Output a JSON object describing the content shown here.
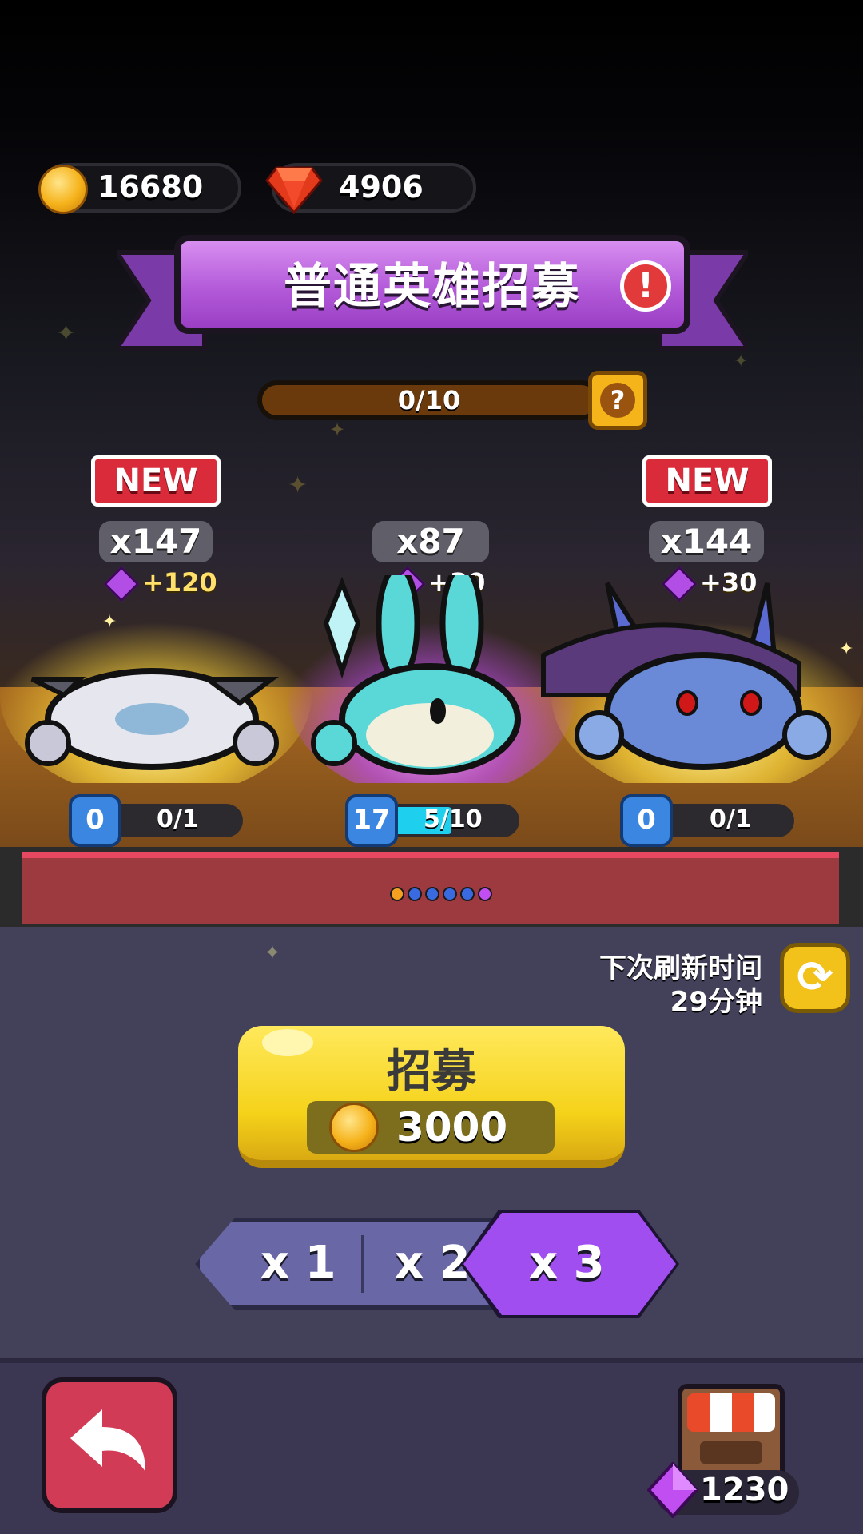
{
  "currency": {
    "gold": "16680",
    "gems": "4906",
    "colors": {
      "gold": "#f5b21a",
      "gems": "#e23a1a"
    }
  },
  "banner": {
    "title": "普通英雄招募",
    "alert_icon": "exclamation-icon",
    "alert_text": "!"
  },
  "progress": {
    "text": "0/10",
    "value": 0,
    "max": 10,
    "help_text": "?"
  },
  "heroes": [
    {
      "new_label": "NEW",
      "count": "x147",
      "gem_bonus": "+120",
      "level": "0",
      "progress_text": "0/1",
      "progress_value": 0,
      "progress_max": 1,
      "glow": "#ffd83a"
    },
    {
      "new_label": "",
      "count": "x87",
      "gem_bonus": "+30",
      "level": "17",
      "progress_text": "5/10",
      "progress_value": 5,
      "progress_max": 10,
      "glow": "#c04ef0"
    },
    {
      "new_label": "NEW",
      "count": "x144",
      "gem_bonus": "+30",
      "level": "0",
      "progress_text": "0/1",
      "progress_value": 0,
      "progress_max": 1,
      "glow": "#ffd83a"
    }
  ],
  "page_dots": {
    "count": 6,
    "colors": [
      "#f5a020",
      "#3a6ae0",
      "#3a6ae0",
      "#3a6ae0",
      "#3a6ae0",
      "#c04ef0"
    ]
  },
  "refresh": {
    "label": "下次刷新时间",
    "time": "29分钟",
    "icon": "refresh-icon"
  },
  "recruit": {
    "label": "招募",
    "cost": "3000",
    "cost_icon": "coin-icon"
  },
  "multiplier": {
    "options": [
      "x 1",
      "x 2",
      "x 3"
    ],
    "selected": "x 3"
  },
  "footer": {
    "back_icon": "back-arrow-icon",
    "shop_icon": "shop-icon",
    "shop_gems": "1230"
  }
}
